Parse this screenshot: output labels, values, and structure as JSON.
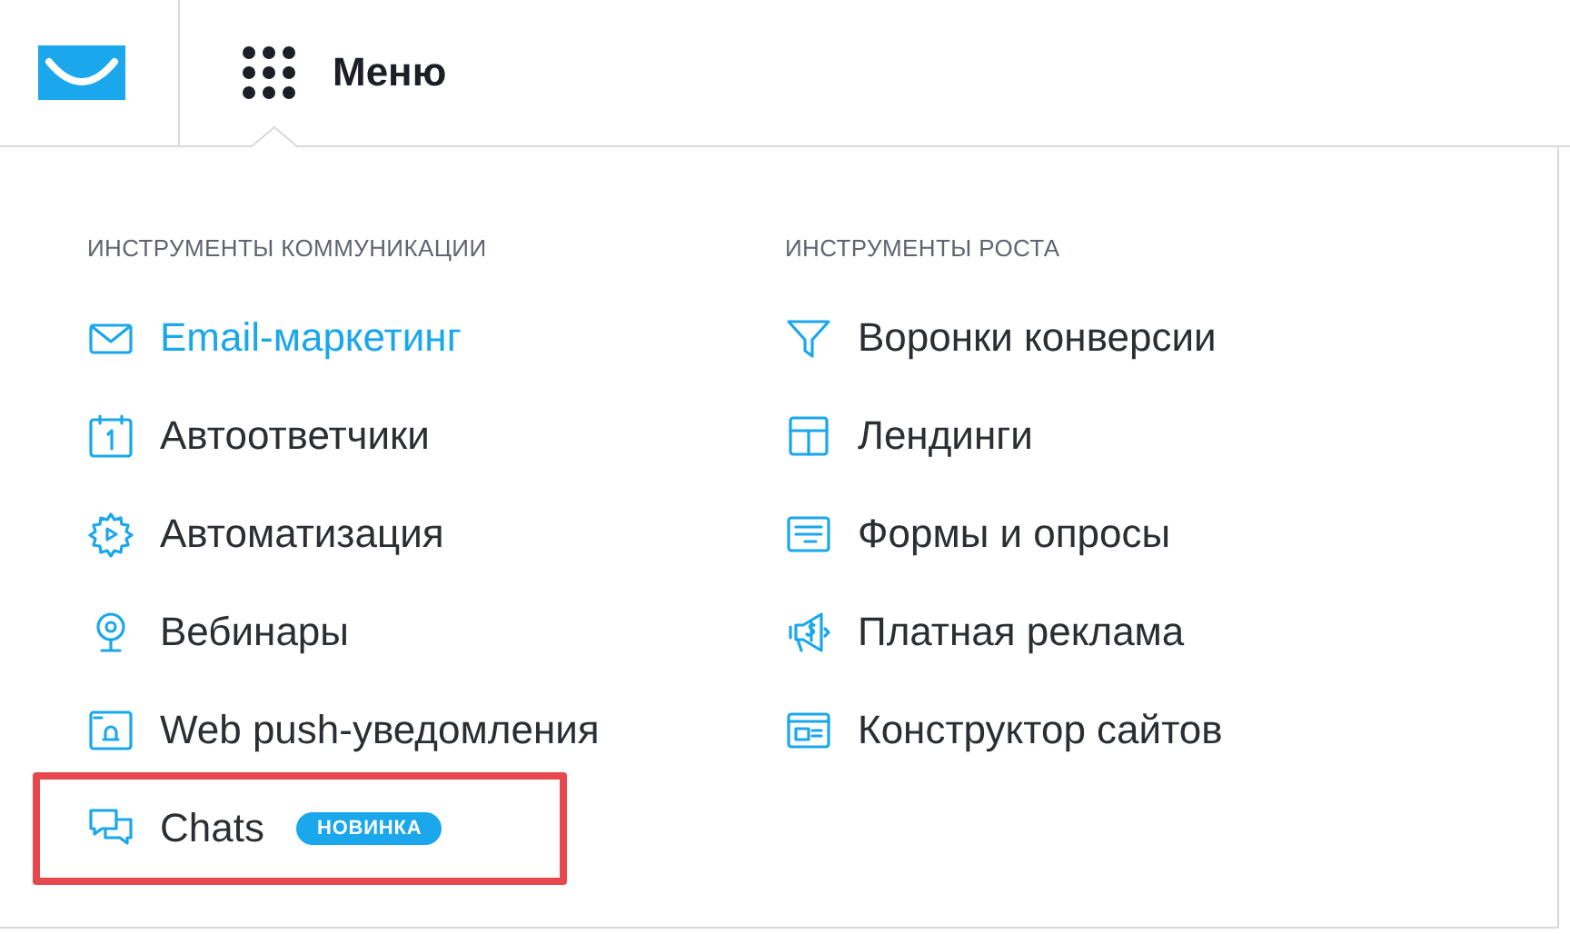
{
  "header": {
    "menu_label": "Меню"
  },
  "columns": [
    {
      "heading": "ИНСТРУМЕНТЫ КОММУНИКАЦИИ",
      "items": [
        {
          "label": "Email-маркетинг",
          "selected": true,
          "highlighted": false
        },
        {
          "label": "Автоответчики",
          "selected": false,
          "highlighted": false
        },
        {
          "label": "Автоматизация",
          "selected": false,
          "highlighted": false
        },
        {
          "label": "Вебинары",
          "selected": false,
          "highlighted": false
        },
        {
          "label": "Web push-уведомления",
          "selected": false,
          "highlighted": false
        },
        {
          "label": "Chats",
          "badge": "НОВИНКА",
          "selected": false,
          "highlighted": true
        }
      ]
    },
    {
      "heading": "ИНСТРУМЕНТЫ РОСТА",
      "items": [
        {
          "label": "Воронки конверсии",
          "selected": false,
          "highlighted": false
        },
        {
          "label": "Лендинги",
          "selected": false,
          "highlighted": false
        },
        {
          "label": "Формы и опросы",
          "selected": false,
          "highlighted": false
        },
        {
          "label": "Платная реклама",
          "selected": false,
          "highlighted": false
        },
        {
          "label": "Конструктор сайтов",
          "selected": false,
          "highlighted": false
        }
      ]
    }
  ]
}
